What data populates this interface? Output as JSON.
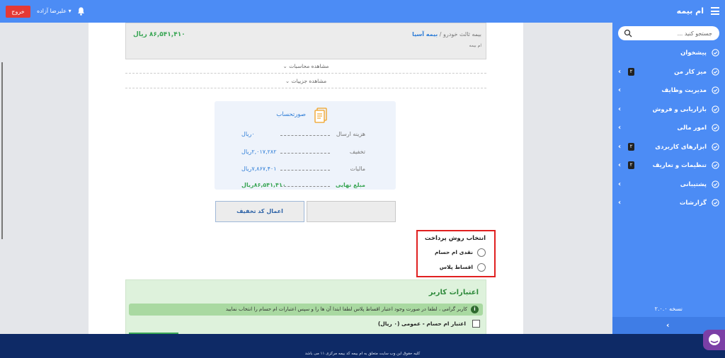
{
  "header": {
    "brand": "ام بیمه",
    "user_name": "علیرضا آزاده",
    "logout_label": "خروج"
  },
  "sidebar": {
    "search_placeholder": "جستجو کنید ...",
    "items": [
      {
        "label": "پیشخوان",
        "badge": "",
        "has_chevron": false
      },
      {
        "label": "میز کار من",
        "badge": "۲",
        "has_chevron": true
      },
      {
        "label": "مدیریت وظایف",
        "badge": "",
        "has_chevron": true
      },
      {
        "label": "بازاریابی و فروش",
        "badge": "",
        "has_chevron": true
      },
      {
        "label": "امور مالی",
        "badge": "",
        "has_chevron": true
      },
      {
        "label": "ابزارهای کاربردی",
        "badge": "۲",
        "has_chevron": true
      },
      {
        "label": "تنظیمات و تعاریف",
        "badge": "۲",
        "has_chevron": true
      },
      {
        "label": "پشتیبانی",
        "badge": "",
        "has_chevron": true
      },
      {
        "label": "گزارشات",
        "badge": "",
        "has_chevron": true
      }
    ],
    "version": "نسخه ۲.۰.۰"
  },
  "order": {
    "insurance_type": "بیمه ثالث خودرو",
    "separator": "/",
    "company": "بیمه آسیا",
    "subtitle": "ام بیمه",
    "price": "۸۶,۵۴۱,۴۱۰ ریال"
  },
  "view_calculations": "مشاهده محاسبات",
  "view_details": "مشاهده جزییات",
  "invoice": {
    "title": "صورتحساب",
    "rows": [
      {
        "label": "هزینه ارسال",
        "value": "۰ریال"
      },
      {
        "label": "تخفیف",
        "value": "۲,۰۱۷,۲۸۲ریال"
      },
      {
        "label": "مالیات",
        "value": "۷,۸۶۷,۴۰۱ریال"
      },
      {
        "label": "مبلغ نهایی",
        "value": "۸۶,۵۴۱,۴۱۰ریال"
      }
    ]
  },
  "buttons": {
    "apply_discount": "اعمال کد تخفیف",
    "secondary": ""
  },
  "payment": {
    "title": "انتخاب روش پرداخت",
    "options": [
      "نقدی ام حسام",
      "اقساط پلاس"
    ]
  },
  "credit": {
    "title": "اعتبارات کاربر",
    "alert": "کاربر گرامی ، لطفا در صورت وجود اعتبار اقساط پلاس لطفا ابتدا آن ها را و سپس اعتبارات ام حسام را انتخاب نمایید",
    "option": "اعتبار ام حسام - عمومی (۰ ریال)"
  },
  "footer": {
    "copyright": "کلیه حقوق این وب سایت متعلق به ام بیمه کد بیمه مرکزی ۱۱ می باشد"
  },
  "colors": {
    "primary": "#4c8cf5",
    "footer": "#0e2a66",
    "danger": "#e53935",
    "success": "#3aa655",
    "link": "#2e7dd7"
  }
}
